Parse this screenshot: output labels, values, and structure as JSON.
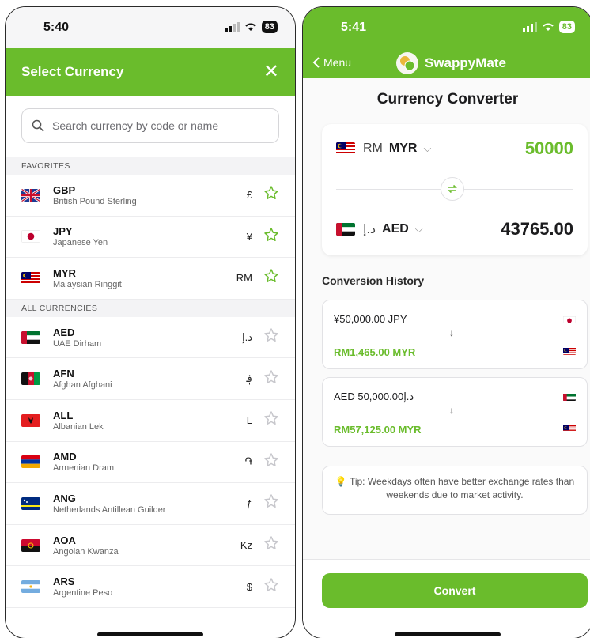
{
  "left": {
    "status": {
      "time": "5:40",
      "battery": "83"
    },
    "header": {
      "title": "Select Currency",
      "close": "✕"
    },
    "search": {
      "placeholder": "Search currency by code or name"
    },
    "favorites_label": "FAVORITES",
    "favorites": [
      {
        "code": "GBP",
        "name": "British Pound Sterling",
        "symbol": "£",
        "flag": "gb",
        "starred": true
      },
      {
        "code": "JPY",
        "name": "Japanese Yen",
        "symbol": "¥",
        "flag": "jp",
        "starred": true
      },
      {
        "code": "MYR",
        "name": "Malaysian Ringgit",
        "symbol": "RM",
        "flag": "my",
        "starred": true
      }
    ],
    "all_label": "ALL CURRENCIES",
    "all": [
      {
        "code": "AED",
        "name": "UAE Dirham",
        "symbol": "د.إ",
        "flag": "ae",
        "starred": false
      },
      {
        "code": "AFN",
        "name": "Afghan Afghani",
        "symbol": "؋",
        "flag": "af",
        "starred": false
      },
      {
        "code": "ALL",
        "name": "Albanian Lek",
        "symbol": "L",
        "flag": "al",
        "starred": false
      },
      {
        "code": "AMD",
        "name": "Armenian Dram",
        "symbol": "֏",
        "flag": "am",
        "starred": false
      },
      {
        "code": "ANG",
        "name": "Netherlands Antillean Guilder",
        "symbol": "ƒ",
        "flag": "cw",
        "starred": false
      },
      {
        "code": "AOA",
        "name": "Angolan Kwanza",
        "symbol": "Kz",
        "flag": "ao",
        "starred": false
      },
      {
        "code": "ARS",
        "name": "Argentine Peso",
        "symbol": "$",
        "flag": "ar",
        "starred": false
      }
    ]
  },
  "right": {
    "status": {
      "time": "5:41",
      "battery": "83"
    },
    "nav": {
      "back_label": "Menu",
      "app_name": "SwappyMate"
    },
    "title": "Currency Converter",
    "from": {
      "symbol": "RM",
      "code": "MYR",
      "amount": "50000",
      "flag": "my"
    },
    "to": {
      "symbol": "د.إ",
      "code": "AED",
      "amount": "43765.00",
      "flag": "ae"
    },
    "history_label": "Conversion History",
    "history": [
      {
        "from": "¥50,000.00 JPY",
        "to": "RM1,465.00 MYR",
        "from_flag": "jp",
        "to_flag": "my"
      },
      {
        "from": "AED 50,000.00د.إ",
        "to": "RM57,125.00 MYR",
        "from_flag": "ae",
        "to_flag": "my"
      }
    ],
    "tip": "Tip: Weekdays often have better exchange rates than weekends due to market activity.",
    "convert_label": "Convert"
  },
  "colors": {
    "brand_green": "#6abc2c",
    "star_green": "#6abc2c",
    "star_gray": "#c7c7cc"
  }
}
